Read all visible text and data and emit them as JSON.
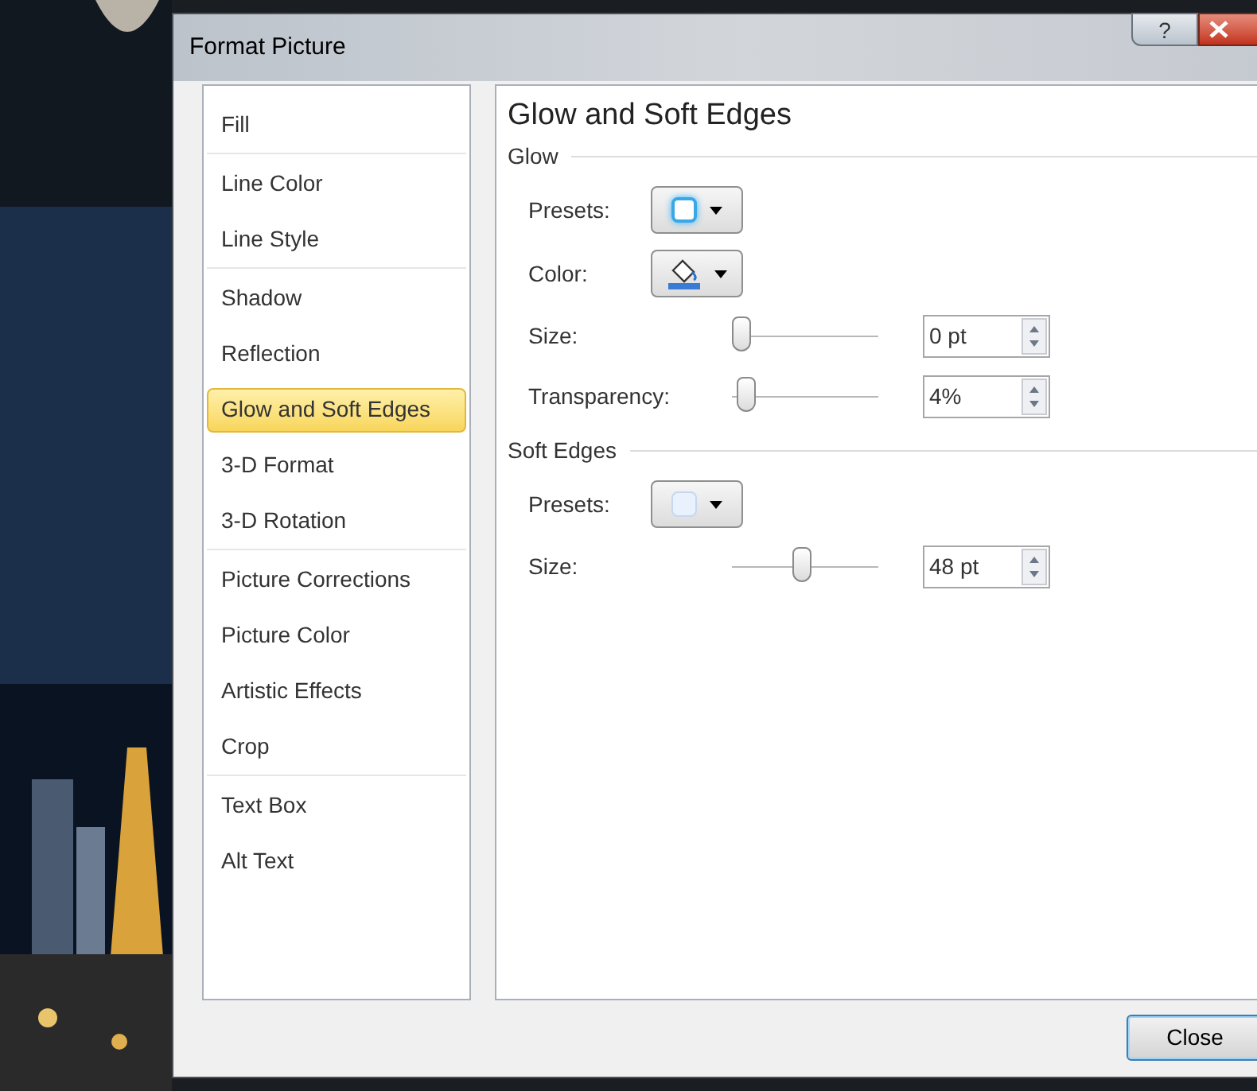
{
  "window": {
    "title": "Format Picture",
    "help_button": "?"
  },
  "categories": [
    {
      "items": [
        {
          "label": "Fill",
          "selected": false
        }
      ]
    },
    {
      "items": [
        {
          "label": "Line Color",
          "selected": false
        },
        {
          "label": "Line Style",
          "selected": false
        }
      ]
    },
    {
      "items": [
        {
          "label": "Shadow",
          "selected": false
        },
        {
          "label": "Reflection",
          "selected": false
        },
        {
          "label": "Glow and Soft Edges",
          "selected": true
        },
        {
          "label": "3-D Format",
          "selected": false
        },
        {
          "label": "3-D Rotation",
          "selected": false
        }
      ]
    },
    {
      "items": [
        {
          "label": "Picture Corrections",
          "selected": false
        },
        {
          "label": "Picture Color",
          "selected": false
        },
        {
          "label": "Artistic Effects",
          "selected": false
        },
        {
          "label": "Crop",
          "selected": false
        }
      ]
    },
    {
      "items": [
        {
          "label": "Text Box",
          "selected": false
        },
        {
          "label": "Alt Text",
          "selected": false
        }
      ]
    }
  ],
  "panel": {
    "title": "Glow and Soft Edges",
    "sections": [
      {
        "title": "Glow",
        "rows": [
          {
            "kind": "preset",
            "label": "Presets:",
            "glow": true
          },
          {
            "kind": "color",
            "label": "Color:"
          },
          {
            "kind": "slider",
            "label": "Size:",
            "level": 0,
            "value": "0 pt"
          },
          {
            "kind": "slider",
            "label": "Transparency:",
            "level": 0.04,
            "value": "4%"
          }
        ]
      },
      {
        "title": "Soft Edges",
        "rows": [
          {
            "kind": "preset",
            "label": "Presets:",
            "glow": false
          },
          {
            "kind": "slider",
            "label": "Size:",
            "level": 0.48,
            "value": "48 pt"
          }
        ]
      }
    ]
  },
  "buttons": [
    "Close"
  ]
}
